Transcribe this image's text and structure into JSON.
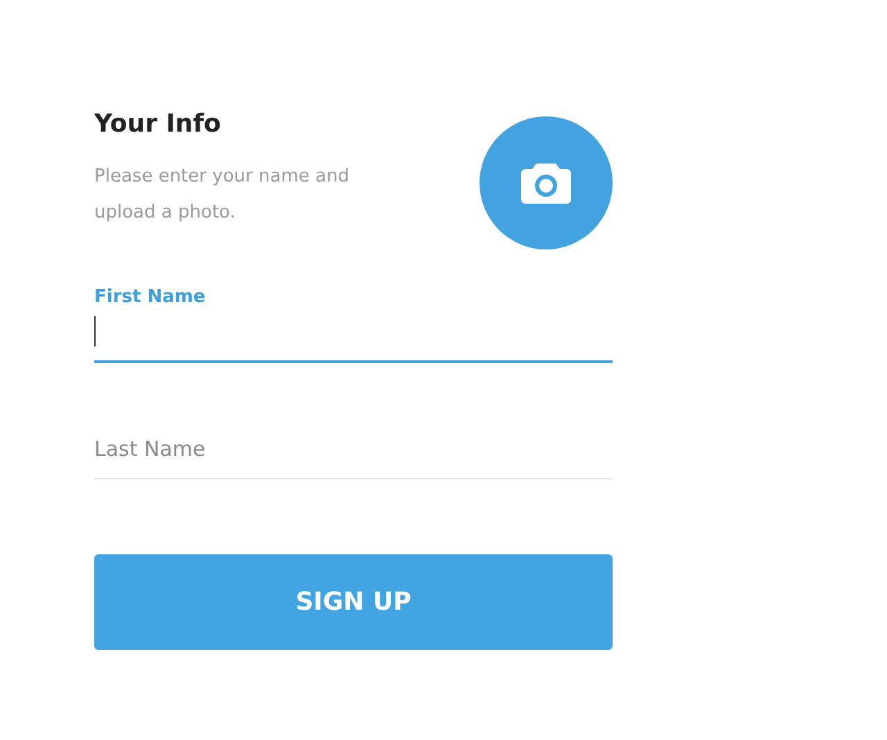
{
  "header": {
    "title": "Your Info",
    "subtitle": "Please enter your name and upload a photo."
  },
  "fields": [
    {
      "label": "First Name",
      "focused": true
    },
    {
      "placeholder": "Last Name",
      "focused": false
    }
  ],
  "button": "SIGN UP"
}
